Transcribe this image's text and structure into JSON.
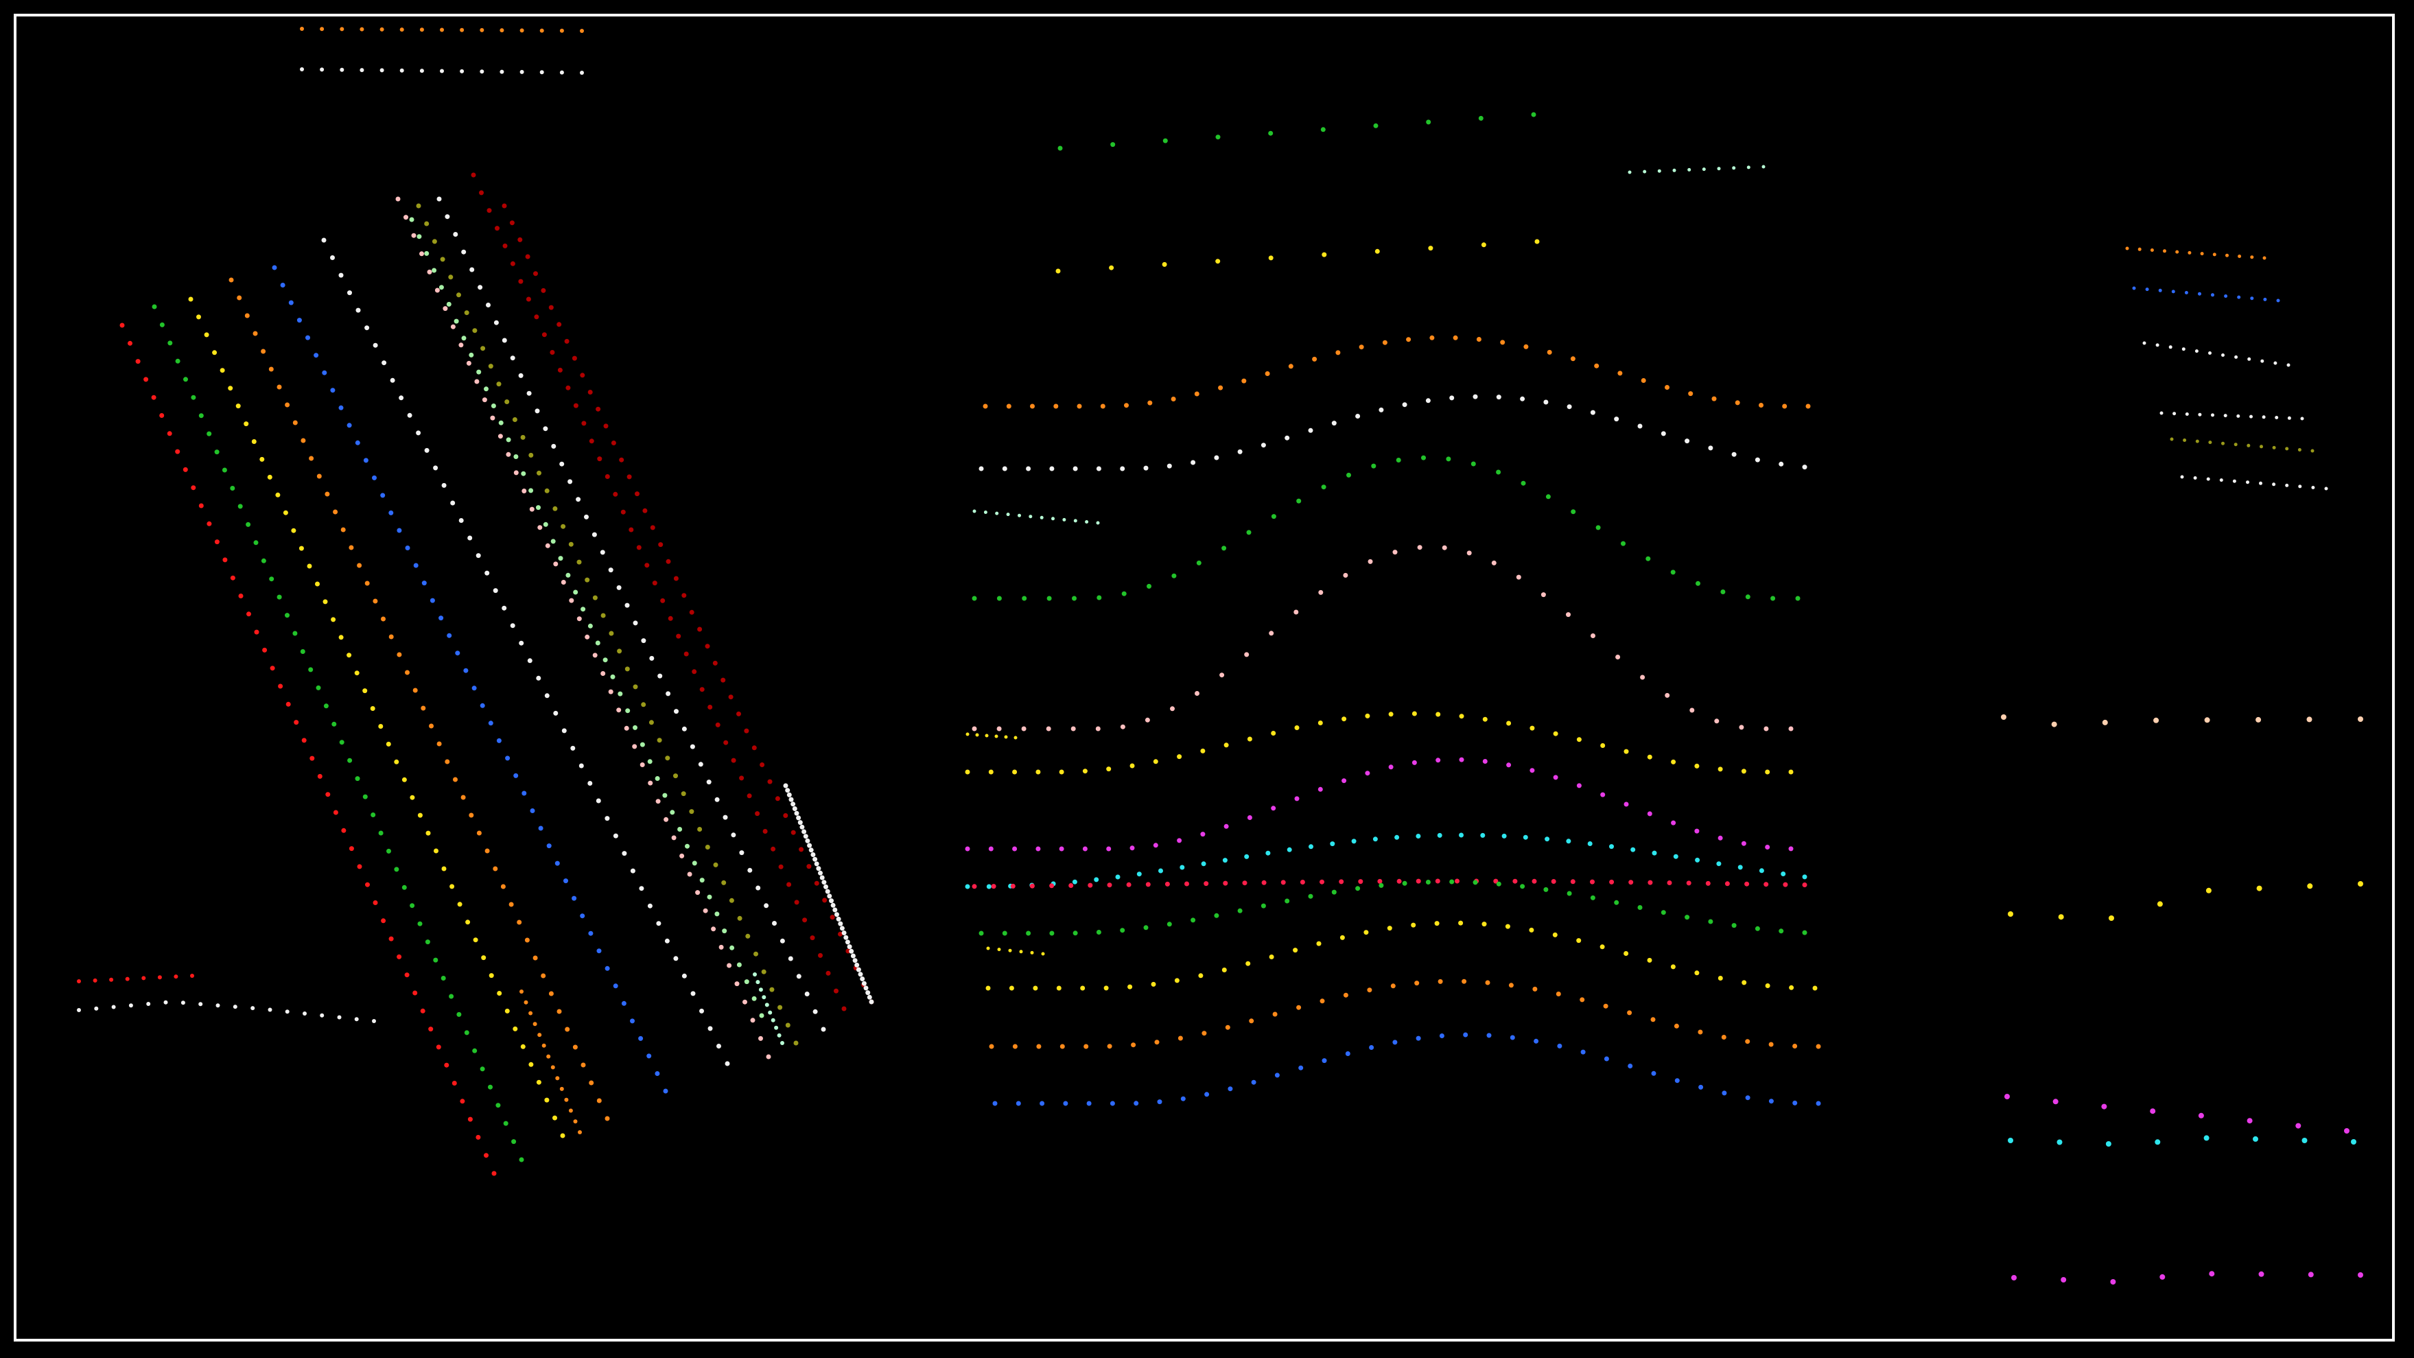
{
  "canvas": {
    "background": "#000000",
    "frame_color": "#ffffff"
  },
  "palette": {
    "red": "#ff1a1a",
    "dark_red": "#b00000",
    "green": "#22c32a",
    "olive": "#9a9a1a",
    "yellow": "#ffe51a",
    "orange": "#ff8a1a",
    "blue": "#2f6bff",
    "white": "#f2f2f2",
    "mint": "#b8ffd6",
    "light_blue": "#a8c8ff",
    "light_green": "#a6f0a6",
    "pink": "#ffc0c0",
    "magenta": "#e83ce8",
    "cyan": "#2ee6ee",
    "crimson": "#ff1f4a",
    "peach": "#ffd0b0"
  }
}
